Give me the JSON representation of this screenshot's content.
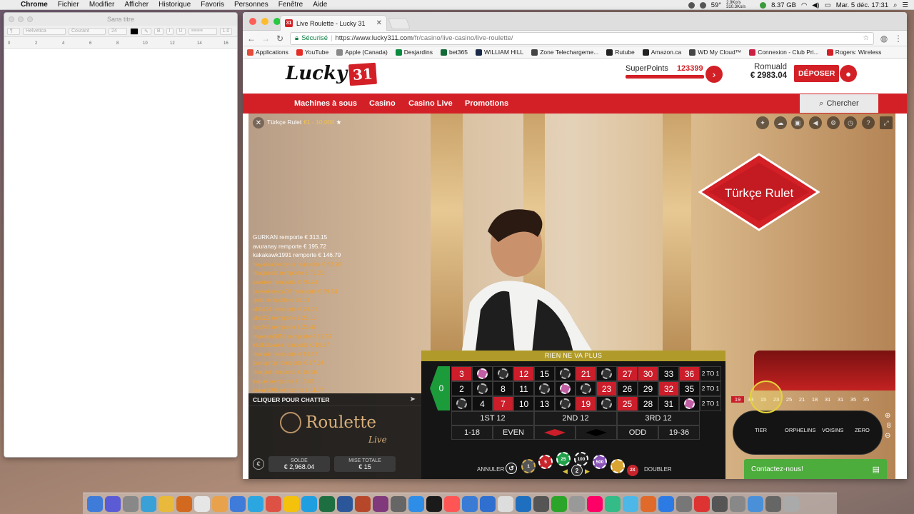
{
  "menubar": {
    "app": "Chrome",
    "items": [
      "Fichier",
      "Modifier",
      "Afficher",
      "Historique",
      "Favoris",
      "Personnes",
      "Fenêtre",
      "Aide"
    ],
    "status": {
      "temp": "59°",
      "net": "2.9Ko/s 310.3Ko/s",
      "memory": "8.37 GB",
      "datetime": "Mar. 5 déc. 17:31"
    }
  },
  "textedit": {
    "title": "Sans titre",
    "font": "Helvetica",
    "style": "Courant",
    "size": "24",
    "ruler_numbers": [
      "0",
      "2",
      "4",
      "6",
      "8",
      "10",
      "12",
      "14",
      "16"
    ]
  },
  "browser": {
    "tab_title": "Live Roulette - Lucky 31",
    "secure_label": "Sécurisé",
    "url_host": "https://www.lucky311.com",
    "url_path": "/fr/casino/live-casino/live-roulette/",
    "bookmarks": [
      {
        "label": "Applications",
        "color": "#e34b3a"
      },
      {
        "label": "YouTube",
        "color": "#e52d27"
      },
      {
        "label": "Apple (Canada)",
        "color": "#888888"
      },
      {
        "label": "Desjardins",
        "color": "#0a8a3e"
      },
      {
        "label": "bet365",
        "color": "#116a36"
      },
      {
        "label": "WILLIAM HILL",
        "color": "#1b2a4b"
      },
      {
        "label": "Zone Telechargeme...",
        "color": "#444444"
      },
      {
        "label": "Rutube",
        "color": "#222222"
      },
      {
        "label": "Amazon.ca",
        "color": "#222222"
      },
      {
        "label": "WD My Cloud™",
        "color": "#444444"
      },
      {
        "label": "Connexion - Club Pri...",
        "color": "#cc1f44"
      },
      {
        "label": "Rogers: Wireless",
        "color": "#d31f26"
      }
    ]
  },
  "site": {
    "logo_text": "Lucky",
    "logo_num": "31",
    "superpoints_label": "SuperPoints",
    "superpoints_value": "123399",
    "user_name": "Romuald",
    "user_balance": "€ 2983.04",
    "deposit_label": "DÉPOSER",
    "nav": [
      "Machines à sous",
      "Casino",
      "Casino Live",
      "Promotions"
    ],
    "search_label": "Chercher",
    "accent": "#d32027"
  },
  "game": {
    "table_name": "Türkçe Rulet",
    "limits": "€1 - 10,000",
    "sign_text": "Türkçe Rulet",
    "winners": [
      {
        "t": "GURKAN remporte € 313.15",
        "c": "#ffffff"
      },
      {
        "t": "avuranay remporte € 195.72",
        "c": "#ffffff"
      },
      {
        "t": "kakakawk1991 remporte € 146.79",
        "c": "#ffffff"
      },
      {
        "t": "hayatsadecoyun remporte € 82.20",
        "c": "#f0a030"
      },
      {
        "t": "magnesia remporte € 78.29",
        "c": "#f0a030"
      },
      {
        "t": "sasuke remporte € 65.24",
        "c": "#f0a030"
      },
      {
        "t": "burkekaraca06 remporte € 39.14",
        "c": "#f0a030"
      },
      {
        "t": "gelo remporte € 39.14",
        "c": "#f0a030"
      },
      {
        "t": "ali0434 remporte € 28.71",
        "c": "#f0a030"
      },
      {
        "t": "ahla23 remporte € 26.10",
        "c": "#f0a030"
      },
      {
        "t": "tuc347 remporte € 23.49",
        "c": "#f0a030"
      },
      {
        "t": "maksim5858 remporte € 19.57",
        "c": "#f0a030"
      },
      {
        "t": "kkakakkaka remporte € 19.57",
        "c": "#f0a030"
      },
      {
        "t": "mahoki remporte € 19.57",
        "c": "#f0a030"
      },
      {
        "t": "panuprop remporte € 17.04",
        "c": "#f0a030"
      },
      {
        "t": "margot remporte € 16.96",
        "c": "#f0a030"
      },
      {
        "t": "kapak remporte € 13.05",
        "c": "#f0a030"
      },
      {
        "t": "sakarat06 remporte € 11.74",
        "c": "#f0a030"
      }
    ],
    "chat_prompt": "CLIQUER POUR CHATTER",
    "brand_main": "Roulette",
    "brand_sub": "Live",
    "balance_label": "SOLDE",
    "balance_value": "€ 2,968.04",
    "total_bet_label": "MISE TOTALE",
    "total_bet_value": "€ 15",
    "board_status": "RIEN NE VA PLUS",
    "zero": "0",
    "grid": [
      [
        {
          "v": "3",
          "k": "r"
        },
        {
          "v": "",
          "k": "chip-pink"
        },
        {
          "v": "",
          "k": "chip"
        },
        {
          "v": "12",
          "k": "r"
        },
        {
          "v": "15",
          "k": "b"
        },
        {
          "v": "",
          "k": "chip"
        },
        {
          "v": "21",
          "k": "r"
        },
        {
          "v": "",
          "k": "chip"
        },
        {
          "v": "27",
          "k": "r"
        },
        {
          "v": "30",
          "k": "r"
        },
        {
          "v": "33",
          "k": "b"
        },
        {
          "v": "36",
          "k": "r"
        },
        {
          "v": "2 TO 1",
          "k": "c"
        }
      ],
      [
        {
          "v": "2",
          "k": "b"
        },
        {
          "v": "",
          "k": "chip"
        },
        {
          "v": "8",
          "k": "b"
        },
        {
          "v": "11",
          "k": "b"
        },
        {
          "v": "",
          "k": "chip"
        },
        {
          "v": "",
          "k": "chip-pink"
        },
        {
          "v": "",
          "k": "chip"
        },
        {
          "v": "23",
          "k": "r"
        },
        {
          "v": "26",
          "k": "b"
        },
        {
          "v": "29",
          "k": "b"
        },
        {
          "v": "32",
          "k": "r"
        },
        {
          "v": "35",
          "k": "b"
        },
        {
          "v": "2 TO 1",
          "k": "c"
        }
      ],
      [
        {
          "v": "",
          "k": "chip"
        },
        {
          "v": "4",
          "k": "b"
        },
        {
          "v": "7",
          "k": "r"
        },
        {
          "v": "10",
          "k": "b"
        },
        {
          "v": "13",
          "k": "b"
        },
        {
          "v": "",
          "k": "chip"
        },
        {
          "v": "19",
          "k": "r"
        },
        {
          "v": "",
          "k": "chip"
        },
        {
          "v": "25",
          "k": "r"
        },
        {
          "v": "28",
          "k": "b"
        },
        {
          "v": "31",
          "k": "b"
        },
        {
          "v": "",
          "k": "chip-pink"
        },
        {
          "v": "2 TO 1",
          "k": "c"
        }
      ]
    ],
    "dozens": [
      "1ST 12",
      "2ND 12",
      "3RD 12"
    ],
    "outside": [
      "1-18",
      "EVEN",
      "",
      "",
      "ODD",
      "19-36"
    ],
    "undo_label": "ANNULER",
    "double_label": "DOUBLER",
    "chip_values": [
      "1",
      "5",
      "25",
      "100",
      "500",
      "2"
    ],
    "selected_chip": "2",
    "history": [
      "19",
      "33",
      "15",
      "23",
      "25",
      "21",
      "18",
      "31",
      "31",
      "35",
      "35"
    ],
    "race_sections": [
      "TIER",
      "ORPHELINS",
      "VOISINS",
      "ZERO"
    ],
    "contact_label": "Contactez-nous!"
  },
  "dock_colors": [
    "#3f7bd8",
    "#5b5bd6",
    "#888",
    "#3aa0d8",
    "#e8b93b",
    "#d2691e",
    "#e6e6e6",
    "#e8a24b",
    "#3f7bd8",
    "#2ca6e0",
    "#de5246",
    "#f4c20d",
    "#1f9fe0",
    "#1d6f42",
    "#2b579a",
    "#b7472a",
    "#80397b",
    "#666",
    "#2e8de6",
    "#1a1a1a",
    "#f55",
    "#3a7bd5",
    "#2f6fd0",
    "#ddd",
    "#1e6fbf",
    "#555",
    "#2aa52a",
    "#999",
    "#f06",
    "#3b8",
    "#4db8e8",
    "#e06a2b",
    "#2c7be5",
    "#777",
    "#d33",
    "#555",
    "#888",
    "#4a90d9",
    "#666",
    "#aaa"
  ]
}
